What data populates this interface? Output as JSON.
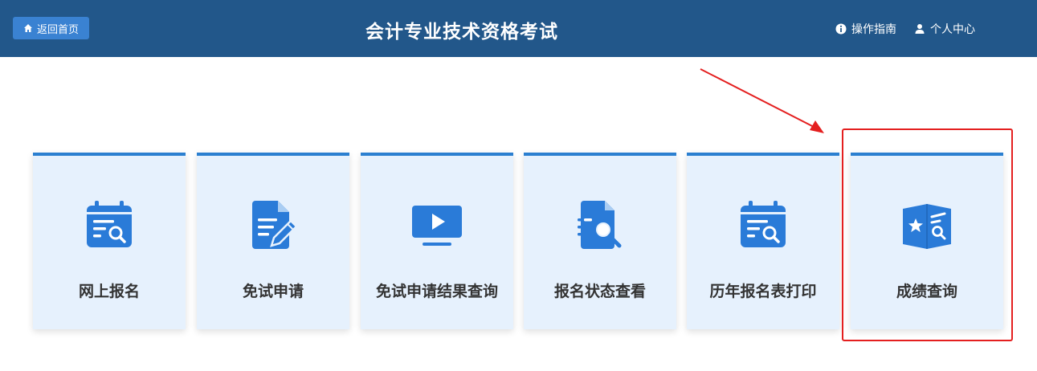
{
  "header": {
    "home_label": "返回首页",
    "title": "会计专业技术资格考试",
    "guide_label": "操作指南",
    "profile_label": "个人中心",
    "bg_color": "#22578a",
    "button_color": "#3a82d2"
  },
  "cards": [
    {
      "label": "网上报名",
      "icon": "calendar-search-icon"
    },
    {
      "label": "免试申请",
      "icon": "document-edit-icon"
    },
    {
      "label": "免试申请结果查询",
      "icon": "monitor-play-icon"
    },
    {
      "label": "报名状态查看",
      "icon": "document-search-icon"
    },
    {
      "label": "历年报名表打印",
      "icon": "calendar-search-icon"
    },
    {
      "label": "成绩查询",
      "icon": "book-star-search-icon"
    }
  ],
  "colors": {
    "card_bg": "#e6f1fd",
    "card_accent": "#2b7fd0",
    "annotation": "#e41f1f"
  }
}
